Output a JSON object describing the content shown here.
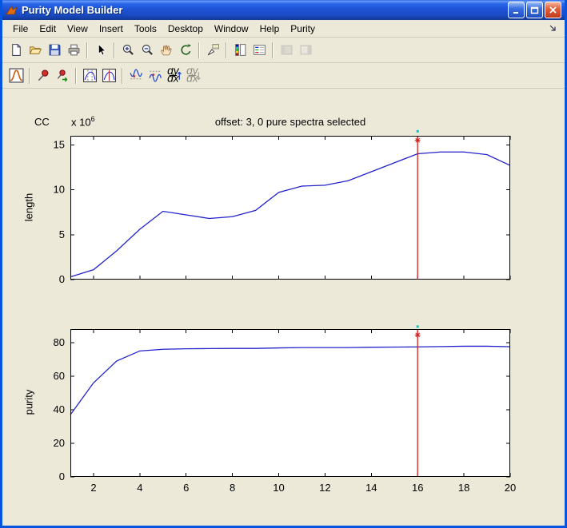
{
  "window": {
    "title": "Purity Model Builder",
    "controls": [
      "minimize",
      "maximize",
      "close"
    ]
  },
  "menu": {
    "items": [
      "File",
      "Edit",
      "View",
      "Insert",
      "Tools",
      "Desktop",
      "Window",
      "Help",
      "Purity"
    ]
  },
  "toolbar_main": {
    "items": [
      "new-file",
      "open-file",
      "save-figure",
      "print-figure",
      "edit-plot",
      "zoom-in",
      "zoom-out",
      "pan",
      "rotate-3d",
      "data-cursor",
      "insert-colorbar",
      "insert-legend",
      "hide-plot-tools",
      "show-plot-tools"
    ]
  },
  "toolbar_purity": {
    "items": [
      "purity-plot",
      "set-pin",
      "export-pin",
      "select-x-range",
      "select-x-point",
      "local-min",
      "local-max",
      "derivative",
      "derivative-alt"
    ],
    "dydx_top": "dy",
    "dydx_bottom": "dx"
  },
  "colors": {
    "line": "#2222cc",
    "cursor": "#d02020",
    "cursor_dot": "#00c8c8",
    "titlebar": "#1e53d6",
    "chrome": "#ece9d8"
  },
  "chart_data": [
    {
      "type": "line",
      "title": "offset: 3, 0 pure spectra selected",
      "corner_label": "CC",
      "ylabel": "length",
      "y_multiplier_base": "x 10",
      "y_multiplier_exp": "6",
      "x": [
        1,
        2,
        3,
        4,
        5,
        6,
        7,
        8,
        9,
        10,
        11,
        12,
        13,
        14,
        15,
        16,
        17,
        18,
        19,
        20
      ],
      "values": [
        0.3,
        1.1,
        3.2,
        5.6,
        7.6,
        7.2,
        6.8,
        7.0,
        7.7,
        9.7,
        10.4,
        10.5,
        11.0,
        12.0,
        13.0,
        14.0,
        14.2,
        14.2,
        13.9,
        12.7
      ],
      "xlim": [
        1,
        20
      ],
      "ylim": [
        0,
        16
      ],
      "yticks": [
        0,
        5,
        10,
        15
      ],
      "xticks": [
        2,
        4,
        6,
        8,
        10,
        12,
        14,
        16,
        18,
        20
      ],
      "show_xtick_labels": false,
      "line_color": "#2222cc",
      "cursor": {
        "x": 16,
        "color": "#d02020",
        "marker_y": 15.5,
        "dot_y": 16.5,
        "dot_color": "#00c8c8"
      }
    },
    {
      "type": "line",
      "title": "",
      "ylabel": "purity",
      "x": [
        1,
        2,
        3,
        4,
        5,
        6,
        7,
        8,
        9,
        10,
        11,
        12,
        13,
        14,
        15,
        16,
        17,
        18,
        19,
        20
      ],
      "values": [
        37,
        56,
        69,
        75,
        76,
        76.3,
        76.4,
        76.5,
        76.5,
        76.8,
        77,
        77,
        77,
        77.2,
        77.3,
        77.4,
        77.6,
        77.8,
        77.8,
        77.5
      ],
      "xlim": [
        1,
        20
      ],
      "ylim": [
        0,
        88
      ],
      "yticks": [
        0,
        20,
        40,
        60,
        80
      ],
      "xticks": [
        2,
        4,
        6,
        8,
        10,
        12,
        14,
        16,
        18,
        20
      ],
      "show_xtick_labels": true,
      "line_color": "#2222cc",
      "cursor": {
        "x": 16,
        "color": "#d02020",
        "marker_y": 84.5,
        "dot_y": 89.5,
        "dot_color": "#00c8c8"
      }
    }
  ]
}
